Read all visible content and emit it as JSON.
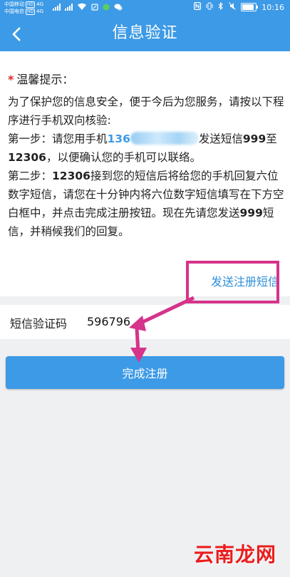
{
  "status_bar": {
    "carrier_1": "中国移动",
    "carrier_2": "中国电信",
    "hd_badge": "HD",
    "network_1": "4G",
    "network_2": "4G",
    "battery_level": 0.8,
    "time": "10:16"
  },
  "header": {
    "title": "信息验证",
    "back_icon": "chevron-left-icon"
  },
  "tip": {
    "star": "*",
    "title": "温馨提示：",
    "intro": "为了保护您的信息安全，便于今后为您服务，请按以下程序进行手机双向核验:",
    "step1_prefix": "第一步：请您用手机",
    "step1_phone": "136",
    "step1_mid": "发送短信",
    "step1_sms_code": "999",
    "step1_to": "至",
    "step1_number": "12306",
    "step1_suffix": "，以便确认您的手机可以联络。",
    "step2_prefix": "第二步：",
    "step2_number": "12306",
    "step2_body": "接到您的短信后将给您的手机回复六位数字短信，请您在十分钟内将六位数字短信填写在下方空白框中，并点击完成注册按钮。现在先请您发送",
    "step2_sms_code": "999",
    "step2_suffix": "短信，并稍候我们的回复。"
  },
  "send_sms_link": "发送注册短信",
  "code_row": {
    "label": "短信验证码",
    "value": "596796"
  },
  "submit_label": "完成注册",
  "watermark": "云南龙网",
  "colors": {
    "primary": "#3d9ae6",
    "annotation": "#d6338a",
    "watermark": "#ea1c1c"
  }
}
